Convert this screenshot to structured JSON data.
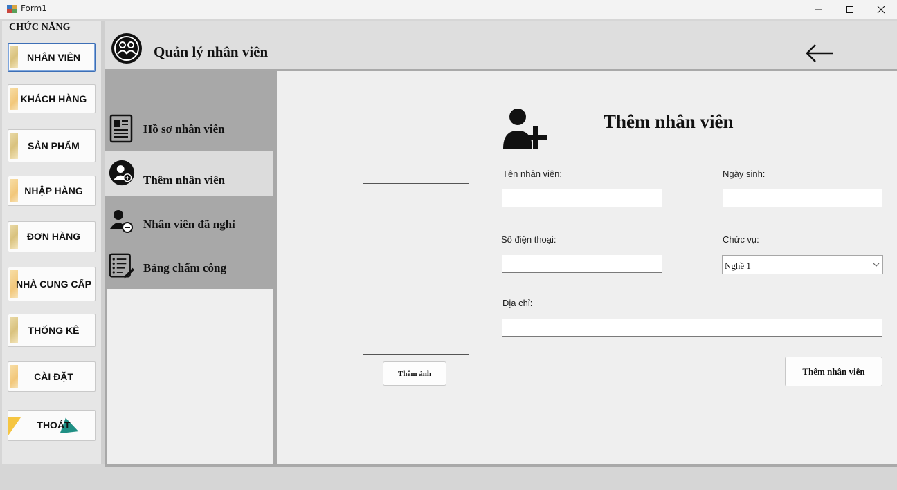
{
  "window": {
    "title": "Form1"
  },
  "sidebar": {
    "title": "CHỨC NĂNG",
    "items": [
      {
        "label": "NHÂN VIÊN"
      },
      {
        "label": "KHÁCH HÀNG"
      },
      {
        "label": "SẢN PHẨM"
      },
      {
        "label": "NHẬP HÀNG"
      },
      {
        "label": "ĐƠN HÀNG"
      },
      {
        "label": "NHÀ CUNG CẤP"
      },
      {
        "label": "THỐNG KÊ"
      },
      {
        "label": "CÀI ĐẶT"
      },
      {
        "label": "THOÁT"
      }
    ]
  },
  "header": {
    "title": "Quản lý nhân viên"
  },
  "submenu": {
    "items": [
      {
        "label": "Hồ sơ nhân viên"
      },
      {
        "label": "Thêm nhân viên"
      },
      {
        "label": "Nhân viên đã nghỉ"
      },
      {
        "label": "Bảng chấm công"
      }
    ]
  },
  "form": {
    "title": "Thêm nhân viên",
    "add_photo_button": "Thêm ảnh",
    "name_label": "Tên nhân viên:",
    "name_value": "",
    "dob_label": "Ngày sinh:",
    "dob_value": "",
    "phone_label": "Số điện thoại:",
    "phone_value": "",
    "position_label": "Chức vụ:",
    "position_value": "Nghề 1",
    "address_label": "Địa chỉ:",
    "address_value": "",
    "submit_button": "Thêm nhân viên"
  }
}
